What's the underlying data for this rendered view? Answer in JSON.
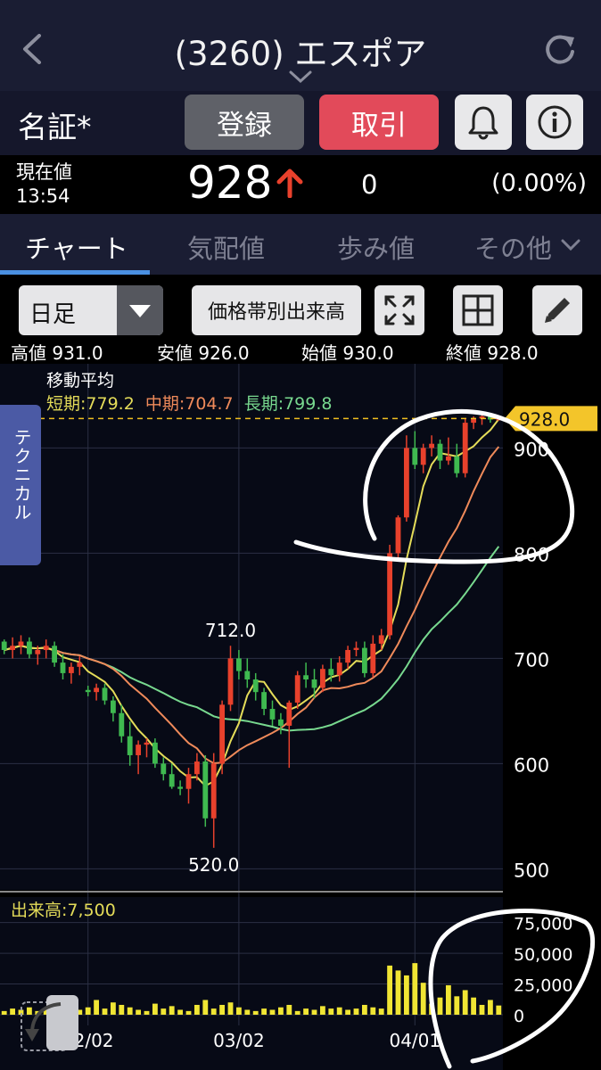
{
  "header": {
    "title": "(3260) エスポア"
  },
  "market": {
    "name": "名証*",
    "register_label": "登録",
    "trade_label": "取引"
  },
  "quote": {
    "label_line1": "現在値",
    "time": "13:54",
    "price": "928",
    "change": "0",
    "change_pct": "(0.00%)"
  },
  "tabs": [
    {
      "label": "チャート",
      "active": true
    },
    {
      "label": "気配値",
      "active": false
    },
    {
      "label": "歩み値",
      "active": false
    },
    {
      "label": "その他",
      "active": false
    }
  ],
  "toolbar": {
    "period": "日足",
    "band_label": "価格帯別出来高"
  },
  "ohlc": {
    "high": "高値 931.0",
    "low": "安値 926.0",
    "open": "始値 930.0",
    "close": "終値 928.0"
  },
  "ma": {
    "title": "移動平均",
    "short": "短期:779.2",
    "mid": "中期:704.7",
    "long": "長期:799.8"
  },
  "technical_label": "テクニカル",
  "chart_data": {
    "type": "candlestick",
    "price_ylim": [
      480,
      980
    ],
    "price_ticks": [
      "900",
      "800",
      "700",
      "600",
      "500"
    ],
    "current_price_tag": "928.0",
    "current_price": 928,
    "annotations": [
      {
        "text": "712.0",
        "value": 712,
        "index": 27
      },
      {
        "text": "520.0",
        "value": 520,
        "index": 25
      }
    ],
    "x_ticks": [
      {
        "label": "02/02",
        "index": 10
      },
      {
        "label": "03/02",
        "index": 28
      },
      {
        "label": "04/01",
        "index": 49
      }
    ],
    "candles": [
      [
        716,
        718,
        704,
        708
      ],
      [
        708,
        720,
        700,
        712
      ],
      [
        712,
        722,
        704,
        716
      ],
      [
        716,
        720,
        700,
        704
      ],
      [
        704,
        712,
        694,
        708
      ],
      [
        708,
        718,
        700,
        712
      ],
      [
        712,
        716,
        692,
        696
      ],
      [
        696,
        704,
        680,
        686
      ],
      [
        686,
        696,
        676,
        692
      ],
      [
        692,
        702,
        684,
        696
      ],
      [
        670,
        674,
        664,
        668
      ],
      [
        668,
        676,
        660,
        672
      ],
      [
        672,
        676,
        656,
        660
      ],
      [
        660,
        664,
        640,
        648
      ],
      [
        648,
        656,
        620,
        626
      ],
      [
        626,
        640,
        598,
        608
      ],
      [
        608,
        622,
        590,
        618
      ],
      [
        618,
        624,
        606,
        620
      ],
      [
        620,
        624,
        596,
        600
      ],
      [
        600,
        606,
        584,
        590
      ],
      [
        590,
        600,
        576,
        578
      ],
      [
        578,
        584,
        570,
        576
      ],
      [
        576,
        596,
        562,
        590
      ],
      [
        590,
        610,
        584,
        602
      ],
      [
        602,
        608,
        540,
        548
      ],
      [
        548,
        610,
        520,
        600
      ],
      [
        600,
        660,
        590,
        656
      ],
      [
        656,
        712,
        650,
        700
      ],
      [
        700,
        708,
        680,
        688
      ],
      [
        688,
        700,
        672,
        680
      ],
      [
        680,
        686,
        660,
        668
      ],
      [
        668,
        672,
        646,
        652
      ],
      [
        652,
        660,
        636,
        642
      ],
      [
        642,
        648,
        628,
        636
      ],
      [
        636,
        660,
        596,
        658
      ],
      [
        658,
        688,
        652,
        684
      ],
      [
        684,
        696,
        672,
        680
      ],
      [
        680,
        690,
        662,
        672
      ],
      [
        672,
        694,
        668,
        690
      ],
      [
        690,
        700,
        678,
        684
      ],
      [
        684,
        702,
        678,
        696
      ],
      [
        696,
        712,
        690,
        708
      ],
      [
        708,
        716,
        702,
        710
      ],
      [
        710,
        716,
        682,
        686
      ],
      [
        686,
        722,
        682,
        714
      ],
      [
        714,
        728,
        708,
        722
      ],
      [
        722,
        808,
        718,
        800
      ],
      [
        800,
        836,
        796,
        834
      ],
      [
        834,
        912,
        830,
        900
      ],
      [
        900,
        916,
        880,
        884
      ],
      [
        884,
        904,
        876,
        900
      ],
      [
        900,
        912,
        892,
        904
      ],
      [
        904,
        908,
        880,
        888
      ],
      [
        888,
        910,
        884,
        892
      ],
      [
        892,
        904,
        872,
        876
      ],
      [
        876,
        928,
        872,
        924
      ],
      [
        924,
        930,
        918,
        928
      ],
      [
        928,
        932,
        922,
        930
      ],
      [
        930,
        931,
        924,
        927
      ],
      [
        927,
        931,
        926,
        928
      ]
    ],
    "volume_ylim": [
      0,
      90000
    ],
    "volume_ticks": [
      "75,000",
      "50,000",
      "25,000",
      "0"
    ],
    "volume_label": "出来高:7,500",
    "volume": [
      3000,
      5000,
      4000,
      6000,
      3000,
      4000,
      5000,
      7000,
      3000,
      4000,
      6000,
      12000,
      5000,
      10000,
      8000,
      6000,
      4000,
      3000,
      9000,
      5000,
      7000,
      4000,
      3000,
      8000,
      12000,
      5000,
      8000,
      10000,
      6000,
      4000,
      3000,
      5000,
      4000,
      6000,
      8000,
      3000,
      5000,
      4000,
      7000,
      5000,
      6000,
      4000,
      5000,
      8000,
      6000,
      5000,
      40000,
      36000,
      32000,
      42000,
      26000,
      9000,
      14000,
      24000,
      15000,
      20000,
      14000,
      8000,
      12000,
      7500
    ]
  }
}
